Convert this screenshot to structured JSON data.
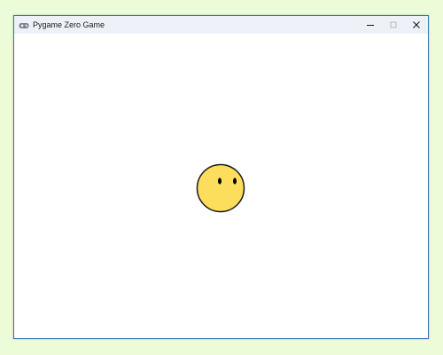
{
  "window": {
    "title": "Pygame Zero Game",
    "app_icon": "gamepad-icon",
    "controls": {
      "minimize_icon": "minimize-icon",
      "maximize_icon": "maximize-icon",
      "close_icon": "close-icon"
    }
  },
  "game": {
    "background_color": "#ffffff",
    "sprite": {
      "name": "face-sprite",
      "fill_color": "#fddd5c",
      "outline_color": "#1a1a1a",
      "eye_color": "#000000"
    }
  }
}
